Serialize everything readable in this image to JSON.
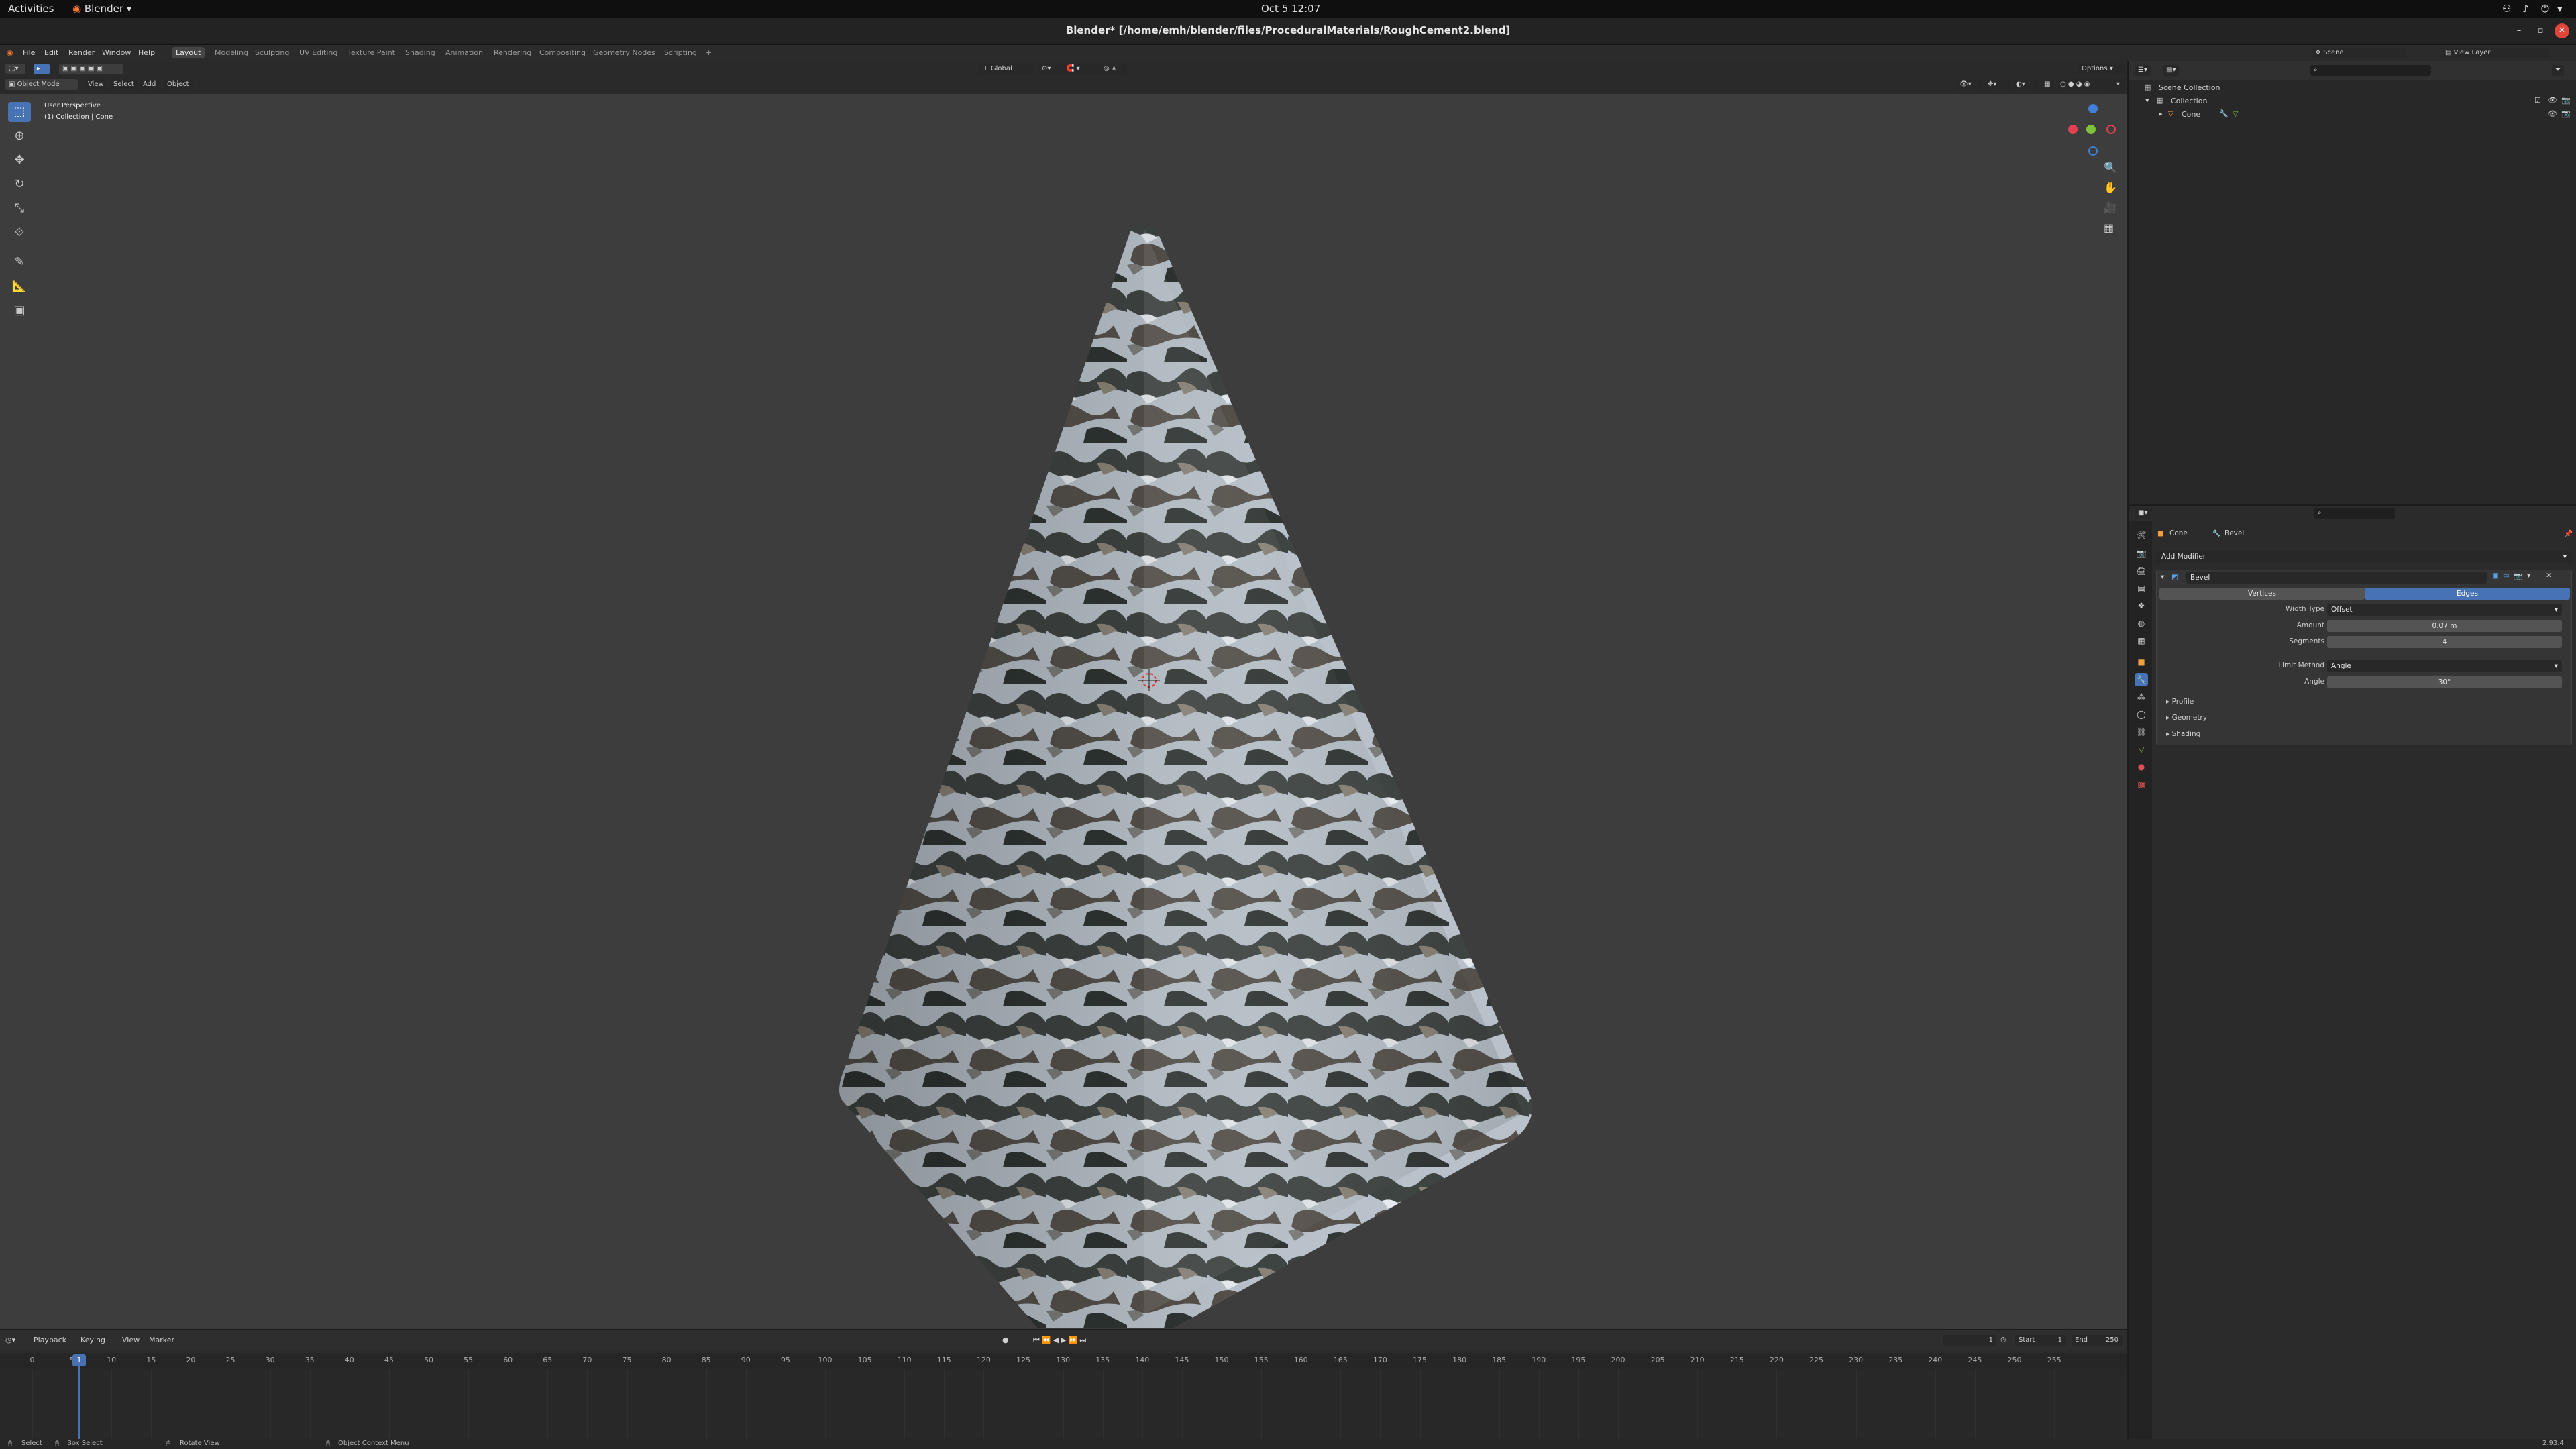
{
  "gnome": {
    "activities": "Activities",
    "app_name": "Blender",
    "clock": "Oct 5  12:07"
  },
  "window": {
    "title": "Blender* [/home/emh/blender/files/ProceduralMaterials/RoughCement2.blend]"
  },
  "menus": [
    "File",
    "Edit",
    "Render",
    "Window",
    "Help"
  ],
  "workspaces": [
    "Layout",
    "Modeling",
    "Sculpting",
    "UV Editing",
    "Texture Paint",
    "Shading",
    "Animation",
    "Rendering",
    "Compositing",
    "Geometry Nodes",
    "Scripting"
  ],
  "workspace_add": "+",
  "active_workspace": "Layout",
  "scene": {
    "scene_name": "Scene",
    "view_layer": "View Layer"
  },
  "viewport": {
    "mode": "Object Mode",
    "menus": [
      "View",
      "Select",
      "Add",
      "Object"
    ],
    "transform_orientation": "Global",
    "options_label": "Options",
    "perspective_label": "User Perspective",
    "context_label": "(1) Collection | Cone"
  },
  "outliner": {
    "items": [
      {
        "label": "Scene Collection"
      },
      {
        "label": "Collection"
      },
      {
        "label": "Cone"
      }
    ]
  },
  "properties": {
    "object_name": "Cone",
    "modifier_tab": "Bevel",
    "add_modifier": "Add Modifier",
    "modifier_name": "Bevel",
    "affect_vertices": "Vertices",
    "affect_edges": "Edges",
    "width_type_label": "Width Type",
    "width_type_value": "Offset",
    "amount_label": "Amount",
    "amount_value": "0.07 m",
    "segments_label": "Segments",
    "segments_value": "4",
    "limit_method_label": "Limit Method",
    "limit_method_value": "Angle",
    "angle_label": "Angle",
    "angle_value": "30°",
    "subpanels": [
      "Profile",
      "Geometry",
      "Shading"
    ]
  },
  "timeline": {
    "menus": [
      "Playback",
      "Keying",
      "View",
      "Marker"
    ],
    "current_frame": "1",
    "start_label": "Start",
    "start_value": "1",
    "end_label": "End",
    "end_value": "250",
    "ruler_ticks": [
      "0",
      "5",
      "10",
      "15",
      "20",
      "25",
      "30",
      "35",
      "40",
      "45",
      "50",
      "55",
      "60",
      "65",
      "70",
      "75",
      "80",
      "85",
      "90",
      "95",
      "100",
      "105",
      "110",
      "115",
      "120",
      "125",
      "130",
      "135",
      "140",
      "145",
      "150",
      "155",
      "160",
      "165",
      "170",
      "175",
      "180",
      "185",
      "190",
      "195",
      "200",
      "205",
      "210",
      "215",
      "220",
      "225",
      "230",
      "235",
      "240",
      "245",
      "250",
      "255"
    ],
    "playhead_label": "1"
  },
  "statusbar": {
    "select": "Select",
    "box_select": "Box Select",
    "rotate_view": "Rotate View",
    "context_menu": "Object Context Menu",
    "version": "2.93.4"
  },
  "colors": {
    "accent": "#4772b3",
    "viewport_bg": "#3d3d3d",
    "panel_bg": "#2b2b2b",
    "x_axis": "#e04050",
    "y_axis": "#7ec23a",
    "z_axis": "#3f7fd6"
  }
}
